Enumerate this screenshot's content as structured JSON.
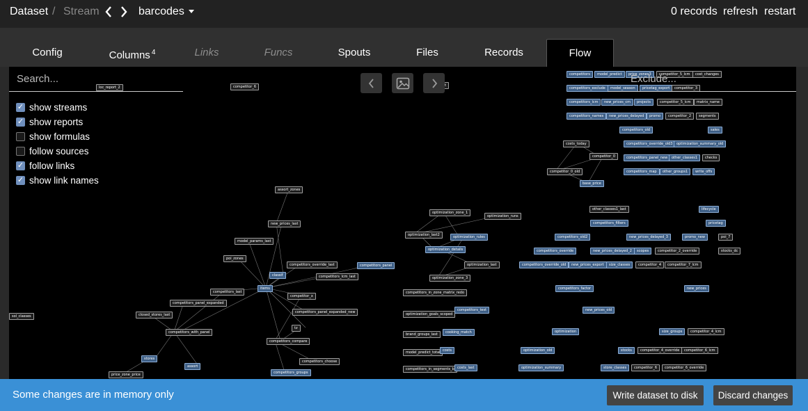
{
  "topbar": {
    "crumb_dataset": "Dataset",
    "crumb_sep": "/",
    "crumb_stream": "Stream",
    "dataset_name": "barcodes",
    "records_count": "0 records",
    "refresh_label": "refresh",
    "restart_label": "restart"
  },
  "tabs": [
    {
      "label": "Config",
      "state": "normal"
    },
    {
      "label": "Columns",
      "badge": "4",
      "state": "normal"
    },
    {
      "label": "Links",
      "state": "disabled"
    },
    {
      "label": "Funcs",
      "state": "disabled"
    },
    {
      "label": "Spouts",
      "state": "normal"
    },
    {
      "label": "Files",
      "state": "normal"
    },
    {
      "label": "Records",
      "state": "normal"
    },
    {
      "label": "Flow",
      "state": "active"
    }
  ],
  "flow": {
    "search_placeholder": "Search...",
    "exclude_placeholder": "Exclude...",
    "options": [
      {
        "label": "show streams",
        "checked": true
      },
      {
        "label": "show reports",
        "checked": true
      },
      {
        "label": "show formulas",
        "checked": false
      },
      {
        "label": "follow sources",
        "checked": false
      },
      {
        "label": "follow links",
        "checked": true
      },
      {
        "label": "show link names",
        "checked": true
      }
    ],
    "controls": [
      "chevron-left-icon",
      "image-icon",
      "chevron-right-icon"
    ]
  },
  "graph_nodes": [
    {
      "label": "loc_report_2",
      "kind": "report"
    },
    {
      "label": "competitor_6",
      "kind": "report"
    },
    {
      "label": "new_report",
      "kind": "report"
    },
    {
      "label": "competitors",
      "kind": "stream"
    },
    {
      "label": "model_predict",
      "kind": "stream"
    },
    {
      "label": "price_zones3",
      "kind": "stream"
    },
    {
      "label": "competitor_5_lcm",
      "kind": "report"
    },
    {
      "label": "cost_changes",
      "kind": "report"
    },
    {
      "label": "competitors_exclude",
      "kind": "stream"
    },
    {
      "label": "model_season",
      "kind": "stream"
    },
    {
      "label": "pricetag_export",
      "kind": "stream"
    },
    {
      "label": "competitor_3",
      "kind": "report"
    },
    {
      "label": "competitors_lcm",
      "kind": "stream"
    },
    {
      "label": "new_prices_cm",
      "kind": "stream"
    },
    {
      "label": "projects",
      "kind": "stream"
    },
    {
      "label": "competitor_5_lcm",
      "kind": "report"
    },
    {
      "label": "matrix_name",
      "kind": "report"
    },
    {
      "label": "competitors_names",
      "kind": "stream"
    },
    {
      "label": "new_prices_delayed",
      "kind": "stream"
    },
    {
      "label": "promo",
      "kind": "stream"
    },
    {
      "label": "competitor_2",
      "kind": "report"
    },
    {
      "label": "segments",
      "kind": "report"
    },
    {
      "label": "competitors_old",
      "kind": "stream"
    },
    {
      "label": "sales",
      "kind": "stream"
    },
    {
      "label": "costs_today",
      "kind": "report"
    },
    {
      "label": "competitors_override_old3",
      "kind": "stream"
    },
    {
      "label": "optimization_summary_old",
      "kind": "stream"
    },
    {
      "label": "competitor_0",
      "kind": "report"
    },
    {
      "label": "competitors_panel_new",
      "kind": "stream"
    },
    {
      "label": "other_classes1",
      "kind": "stream"
    },
    {
      "label": "checks",
      "kind": "report"
    },
    {
      "label": "competitor_0_old",
      "kind": "report"
    },
    {
      "label": "competitors_map",
      "kind": "stream"
    },
    {
      "label": "other_groups1",
      "kind": "stream"
    },
    {
      "label": "write_offs",
      "kind": "stream"
    },
    {
      "label": "base_price",
      "kind": "stream"
    },
    {
      "label": "assort_zones",
      "kind": "report"
    },
    {
      "label": "new_prices_last",
      "kind": "report"
    },
    {
      "label": "model_params_last",
      "kind": "report"
    },
    {
      "label": "poi_zones",
      "kind": "report"
    },
    {
      "label": "competitors_override_last",
      "kind": "report"
    },
    {
      "label": "competitors_panel",
      "kind": "stream"
    },
    {
      "label": "classif",
      "kind": "stream"
    },
    {
      "label": "competitors_lcm_last",
      "kind": "report"
    },
    {
      "label": "items",
      "kind": "stream"
    },
    {
      "label": "competitors_last",
      "kind": "report"
    },
    {
      "label": "competitor_x",
      "kind": "report"
    },
    {
      "label": "competitors_panel_expanded",
      "kind": "report"
    },
    {
      "label": "competitors_panel_expanded_new",
      "kind": "report"
    },
    {
      "label": "closed_stores_last",
      "kind": "report"
    },
    {
      "label": "competitors_with_panel",
      "kind": "report"
    },
    {
      "label": "tz",
      "kind": "report"
    },
    {
      "label": "competitors_compare",
      "kind": "report"
    },
    {
      "label": "competitors_choose",
      "kind": "report"
    },
    {
      "label": "stores",
      "kind": "stream"
    },
    {
      "label": "assort",
      "kind": "stream"
    },
    {
      "label": "price_zone_price",
      "kind": "report"
    },
    {
      "label": "competitors_groups",
      "kind": "stream"
    },
    {
      "label": "sol_classes",
      "kind": "report"
    },
    {
      "label": "optimization_zone_1",
      "kind": "report"
    },
    {
      "label": "optimization_runs",
      "kind": "report"
    },
    {
      "label": "optimization_last2",
      "kind": "report"
    },
    {
      "label": "optimization_rules",
      "kind": "stream"
    },
    {
      "label": "optimization_details",
      "kind": "stream"
    },
    {
      "label": "optimization_last",
      "kind": "report"
    },
    {
      "label": "optimization_zone_3",
      "kind": "report"
    },
    {
      "label": "competitors_in_zone_matrix_redo",
      "kind": "report"
    },
    {
      "label": "optimization_goals_scoped",
      "kind": "report"
    },
    {
      "label": "competitors_test",
      "kind": "stream"
    },
    {
      "label": "brand_groups_last",
      "kind": "report"
    },
    {
      "label": "cooking_match",
      "kind": "stream"
    },
    {
      "label": "model_predict_total",
      "kind": "report"
    },
    {
      "label": "costs",
      "kind": "stream"
    },
    {
      "label": "competitors_in_segments_b",
      "kind": "report"
    },
    {
      "label": "costs_last",
      "kind": "stream"
    },
    {
      "label": "other_classes1_last",
      "kind": "report"
    },
    {
      "label": "lifecycle",
      "kind": "stream"
    },
    {
      "label": "competitors_filters",
      "kind": "stream"
    },
    {
      "label": "pricetag",
      "kind": "stream"
    },
    {
      "label": "competitors_old2",
      "kind": "stream"
    },
    {
      "label": "new_prices_delayed_3",
      "kind": "stream"
    },
    {
      "label": "promo_new",
      "kind": "stream"
    },
    {
      "label": "poi_7",
      "kind": "report"
    },
    {
      "label": "competitors_override",
      "kind": "stream"
    },
    {
      "label": "new_prices_delayed_2",
      "kind": "stream"
    },
    {
      "label": "scopes",
      "kind": "stream"
    },
    {
      "label": "competitor_2_override",
      "kind": "report"
    },
    {
      "label": "stocks_dc",
      "kind": "report"
    },
    {
      "label": "competitors_override_old",
      "kind": "stream"
    },
    {
      "label": "new_prices_export",
      "kind": "stream"
    },
    {
      "label": "size_classes",
      "kind": "stream"
    },
    {
      "label": "competitor_4",
      "kind": "report"
    },
    {
      "label": "competitor_7_lcm",
      "kind": "report"
    },
    {
      "label": "competitors_factor",
      "kind": "stream"
    },
    {
      "label": "new_prices",
      "kind": "stream"
    },
    {
      "label": "new_prices_old",
      "kind": "stream"
    },
    {
      "label": "optimization",
      "kind": "stream"
    },
    {
      "label": "size_groups",
      "kind": "stream"
    },
    {
      "label": "competitor_4_lcm",
      "kind": "report"
    },
    {
      "label": "optimization_old",
      "kind": "stream"
    },
    {
      "label": "stocks",
      "kind": "stream"
    },
    {
      "label": "competitor_4_override",
      "kind": "report"
    },
    {
      "label": "competitor_6_lcm",
      "kind": "report"
    },
    {
      "label": "optimization_summary",
      "kind": "stream"
    },
    {
      "label": "store_classes",
      "kind": "stream"
    },
    {
      "label": "competitor_6",
      "kind": "report"
    },
    {
      "label": "competitor_6_override",
      "kind": "report"
    }
  ],
  "bottombar": {
    "status": "Some changes are in memory only",
    "write_label": "Write dataset to disk",
    "discard_label": "Discard changes"
  }
}
